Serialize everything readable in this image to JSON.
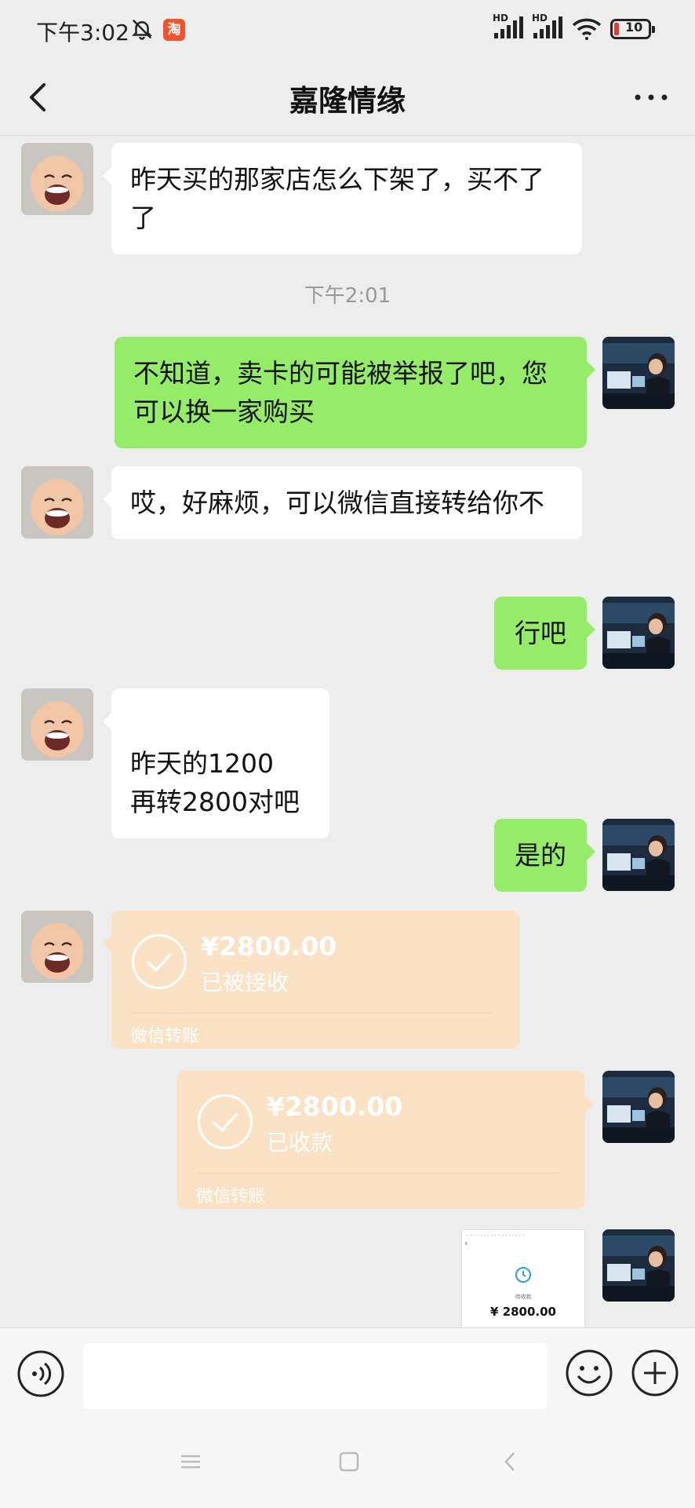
{
  "status_bar": {
    "time": "下午3:02",
    "app_badge": "淘",
    "hd_1": "HD",
    "hd_2": "HD",
    "battery": "10"
  },
  "header": {
    "title": "嘉隆情缘"
  },
  "messages": [
    {
      "side": "left",
      "text": "昨天买的那家店怎么下架了，买不了了"
    },
    {
      "timestamp": "下午2:01"
    },
    {
      "side": "right",
      "text": "不知道，卖卡的可能被举报了吧，您可以换一家购买"
    },
    {
      "side": "left",
      "text": "哎，好麻烦，可以微信直接转给你不"
    },
    {
      "side": "right",
      "text": "行吧"
    },
    {
      "side": "left",
      "text": "昨天的1200\n再转2800对吧"
    },
    {
      "side": "right",
      "text": "是的"
    },
    {
      "side": "left",
      "type": "transfer",
      "amount": "¥2800.00",
      "status": "已被接收",
      "footer": "微信转账"
    },
    {
      "side": "right",
      "type": "transfer",
      "amount": "¥2800.00",
      "status": "已收款",
      "footer": "微信转账"
    },
    {
      "side": "right",
      "type": "image",
      "thumb_status": "待收款",
      "thumb_amount": "¥ 2800.00"
    }
  ],
  "input": {
    "placeholder": ""
  },
  "colors": {
    "background": "#ededed",
    "sent_bubble": "#95ec69",
    "received_bubble": "#ffffff",
    "transfer_card": "#fbe2c4"
  },
  "icons": [
    "bell-off-icon",
    "signal-icon",
    "wifi-icon",
    "battery-icon",
    "back-icon",
    "more-icon",
    "check-icon",
    "clock-icon",
    "voice-icon",
    "emoji-icon",
    "plus-icon",
    "menu-icon",
    "home-icon",
    "nav-back-icon"
  ]
}
